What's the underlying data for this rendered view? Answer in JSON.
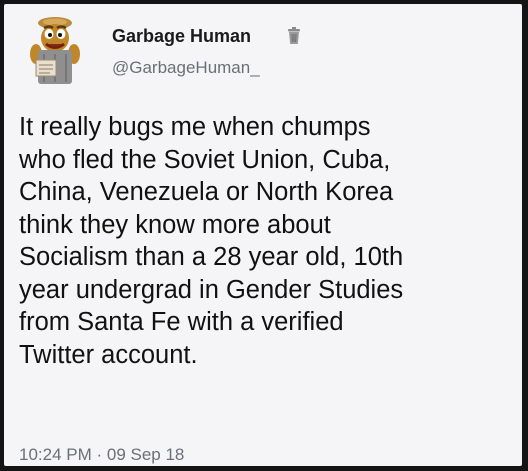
{
  "author": {
    "display_name": "Garbage Human",
    "handle": "@GarbageHuman_",
    "avatar_icon": "oscar-the-grouch-trash-can-avatar",
    "badge_icon": "trash-can-icon"
  },
  "tweet": {
    "lines": [
      "It really bugs me when chumps",
      "who fled the Soviet Union, Cuba,",
      "China, Venezuela or North Korea",
      "think they know more about",
      "Socialism than a 28 year old, 10th",
      "year undergrad in Gender Studies",
      "from Santa Fe with a verified",
      "Twitter account."
    ],
    "timestamp": "10:24 PM · 09 Sep 18"
  }
}
